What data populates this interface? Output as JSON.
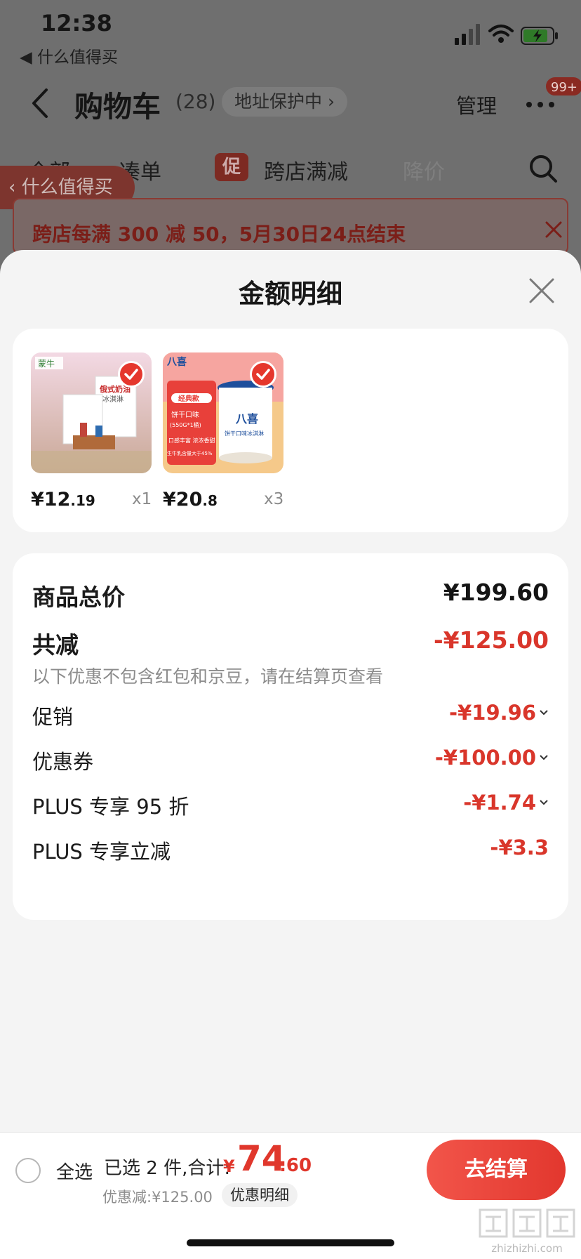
{
  "status_bar": {
    "time": "12:38",
    "back_app": "◀ 什么值得买"
  },
  "header": {
    "title": "购物车",
    "count": "(28)",
    "address_protect": "地址保护中 ›",
    "manage": "管理",
    "badge": "99+"
  },
  "tabs": {
    "all": "全部",
    "bundle": "凑单",
    "promo_mark": "促",
    "cross_store": "跨店满减",
    "price_drop": "降价"
  },
  "floating_back": "‹ 什么值得买",
  "promo_banner": {
    "text": "跨店每满 300 减 50，5月30日24点结束"
  },
  "sheet": {
    "title": "金额明细",
    "products": [
      {
        "price_int": "¥12",
        "price_dec": ".19",
        "qty": "x1"
      },
      {
        "price_int": "¥20",
        "price_dec": ".8",
        "qty": "x3"
      }
    ],
    "product_image_text": {
      "p1_brand": "蒙牛",
      "p1_line1": "俄式奶油",
      "p1_line2": "冰淇淋",
      "p2_brand": "八喜",
      "p2_tag": "经典款",
      "p2_flavor": "饼干口味",
      "p2_spec": "(550G*1桶)",
      "p2_feat": "口感丰富 浓浓香甜",
      "p2_note": "生牛乳含量大于45%",
      "p2_tub": "八喜",
      "p2_tub_sub": "饼干口味冰淇淋"
    },
    "breakdown": {
      "goods_total_label": "商品总价",
      "goods_total_value": "¥199.60",
      "total_reduce_label": "共减",
      "total_reduce_value": "-¥125.00",
      "note": "以下优惠不包含红包和京豆，请在结算页查看",
      "items": [
        {
          "label": "促销",
          "value": "-¥19.96"
        },
        {
          "label": "优惠券",
          "value": "-¥100.00"
        },
        {
          "label": "PLUS 专享 95 折",
          "value": "-¥1.74"
        },
        {
          "label": "PLUS 专享立减",
          "value": "-¥3.3"
        }
      ]
    }
  },
  "bottom_bar": {
    "select_all": "全选",
    "selected_summary": "已选 2 件,合计:",
    "total_symbol": "¥",
    "total_int": "74",
    "total_dec": ".60",
    "discount_text": "优惠减:¥125.00",
    "detail_pill": "优惠明细",
    "checkout": "去结算"
  },
  "watermark": {
    "site": "zhizhizhi.com"
  },
  "colors": {
    "accent_red": "#e0372c",
    "sheet_bg": "#f4f4f4",
    "card_bg": "#ffffff"
  }
}
